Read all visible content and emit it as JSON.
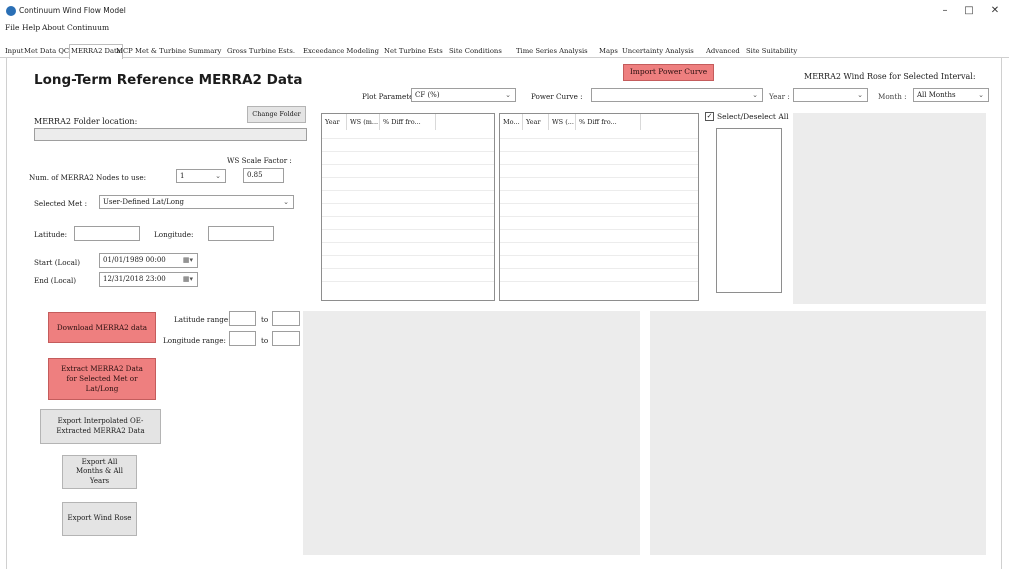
{
  "window": {
    "title": "Continuum Wind Flow Model",
    "minimize_glyph": "–",
    "maximize_glyph": "□",
    "close_glyph": "✕"
  },
  "menu": [
    "File",
    "Help",
    "About Continuum"
  ],
  "tabs": [
    "Input",
    "Met Data QC",
    "MERRA2 Data",
    "MCP",
    "Met & Turbine Summary",
    "Gross Turbine Ests.",
    "Exceedance Modeling",
    "Net Turbine Ests",
    "Site Conditions",
    "Time Series Analysis",
    "Maps",
    "Uncertainty Analysis",
    "Advanced",
    "Site Suitability"
  ],
  "active_tab": "MERRA2 Data",
  "page_title": "Long-Term Reference MERRA2 Data",
  "folder": {
    "label": "MERRA2 Folder location:",
    "change_button": "Change Folder",
    "path": ""
  },
  "ws_scale": {
    "label": "WS Scale Factor :",
    "value": "0.85"
  },
  "nodes": {
    "label": "Num. of MERRA2 Nodes to use:",
    "value": "1"
  },
  "selected_met": {
    "label": "Selected Met :",
    "value": "User-Defined Lat/Long"
  },
  "latitude": {
    "label": "Latitude:",
    "value": ""
  },
  "longitude": {
    "label": "Longitude:",
    "value": ""
  },
  "start": {
    "label": "Start (Local)",
    "value": "01/01/1989 00:00"
  },
  "end": {
    "label": "End (Local)",
    "value": "12/31/2018 23:00"
  },
  "buttons": {
    "download": "Download MERRA2 data",
    "extract": "Extract MERRA2 Data for Selected Met or Lat/Long",
    "export_interp": "Export Interpolated OE-Extracted MERRA2 Data",
    "export_all": "Export All Months & All Years",
    "export_rose": "Export Wind Rose",
    "import_power_curve": "Import Power Curve"
  },
  "lat_range": {
    "label": "Latitude range:",
    "to": "to",
    "from_value": "",
    "to_value": ""
  },
  "long_range": {
    "label": "Longitude range:",
    "to": "to",
    "from_value": "",
    "to_value": ""
  },
  "plot_param": {
    "label": "Plot Parameter:",
    "value": "CF (%)"
  },
  "power_curve": {
    "label": "Power Curve :",
    "value": ""
  },
  "year": {
    "label": "Year :",
    "value": ""
  },
  "month": {
    "label": "Month :",
    "value": "All Months"
  },
  "wind_rose_title": "MERRA2 Wind Rose for Selected Interval:",
  "select_all": {
    "label": "Select/Deselect All",
    "checked": true
  },
  "grid1_headers": [
    "Year",
    "WS (m...",
    "% Diff fro..."
  ],
  "grid2_headers": [
    "Mo...",
    "Year",
    "WS (...",
    "% Diff fro..."
  ],
  "colors": {
    "accent_red": "#ee7f7f",
    "panel_gray": "#ececec",
    "button_gray": "#e4e4e4"
  },
  "icons": [
    "app-icon",
    "calendar-icon",
    "chevron-down-icon",
    "checkbox-icon"
  ]
}
